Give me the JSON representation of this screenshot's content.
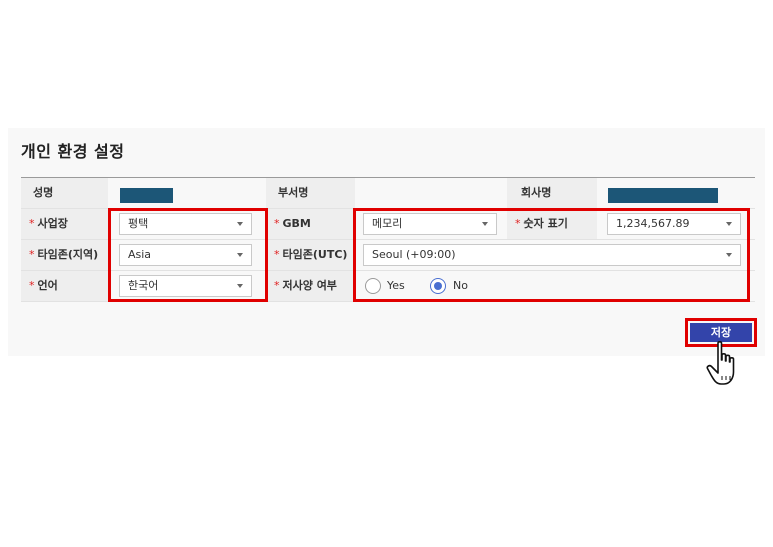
{
  "page": {
    "title": "개인 환경 설정"
  },
  "form": {
    "name_label": "성명",
    "dept_label": "부서명",
    "company_label": "회사명",
    "site_label": "사업장",
    "site_value": "평택",
    "gbm_label": "GBM",
    "gbm_value": "메모리",
    "number_format_label": "숫자 표기",
    "number_format_value": "1,234,567.89",
    "timezone_region_label": "타임존(지역)",
    "timezone_region_value": "Asia",
    "timezone_utc_label": "타임존(UTC)",
    "timezone_utc_value": "Seoul (+09:00)",
    "language_label": "언어",
    "language_value": "한국어",
    "low_spec_label": "저사양 여부",
    "low_spec_options": [
      "Yes",
      "No"
    ],
    "low_spec_selected": "No",
    "required_mark": "*"
  },
  "actions": {
    "save_label": "저장"
  },
  "colors": {
    "redacted_bar": "#1c5677",
    "save_button": "#3344aa",
    "highlight": "#e00000",
    "radio_accent": "#4a6fd0"
  }
}
